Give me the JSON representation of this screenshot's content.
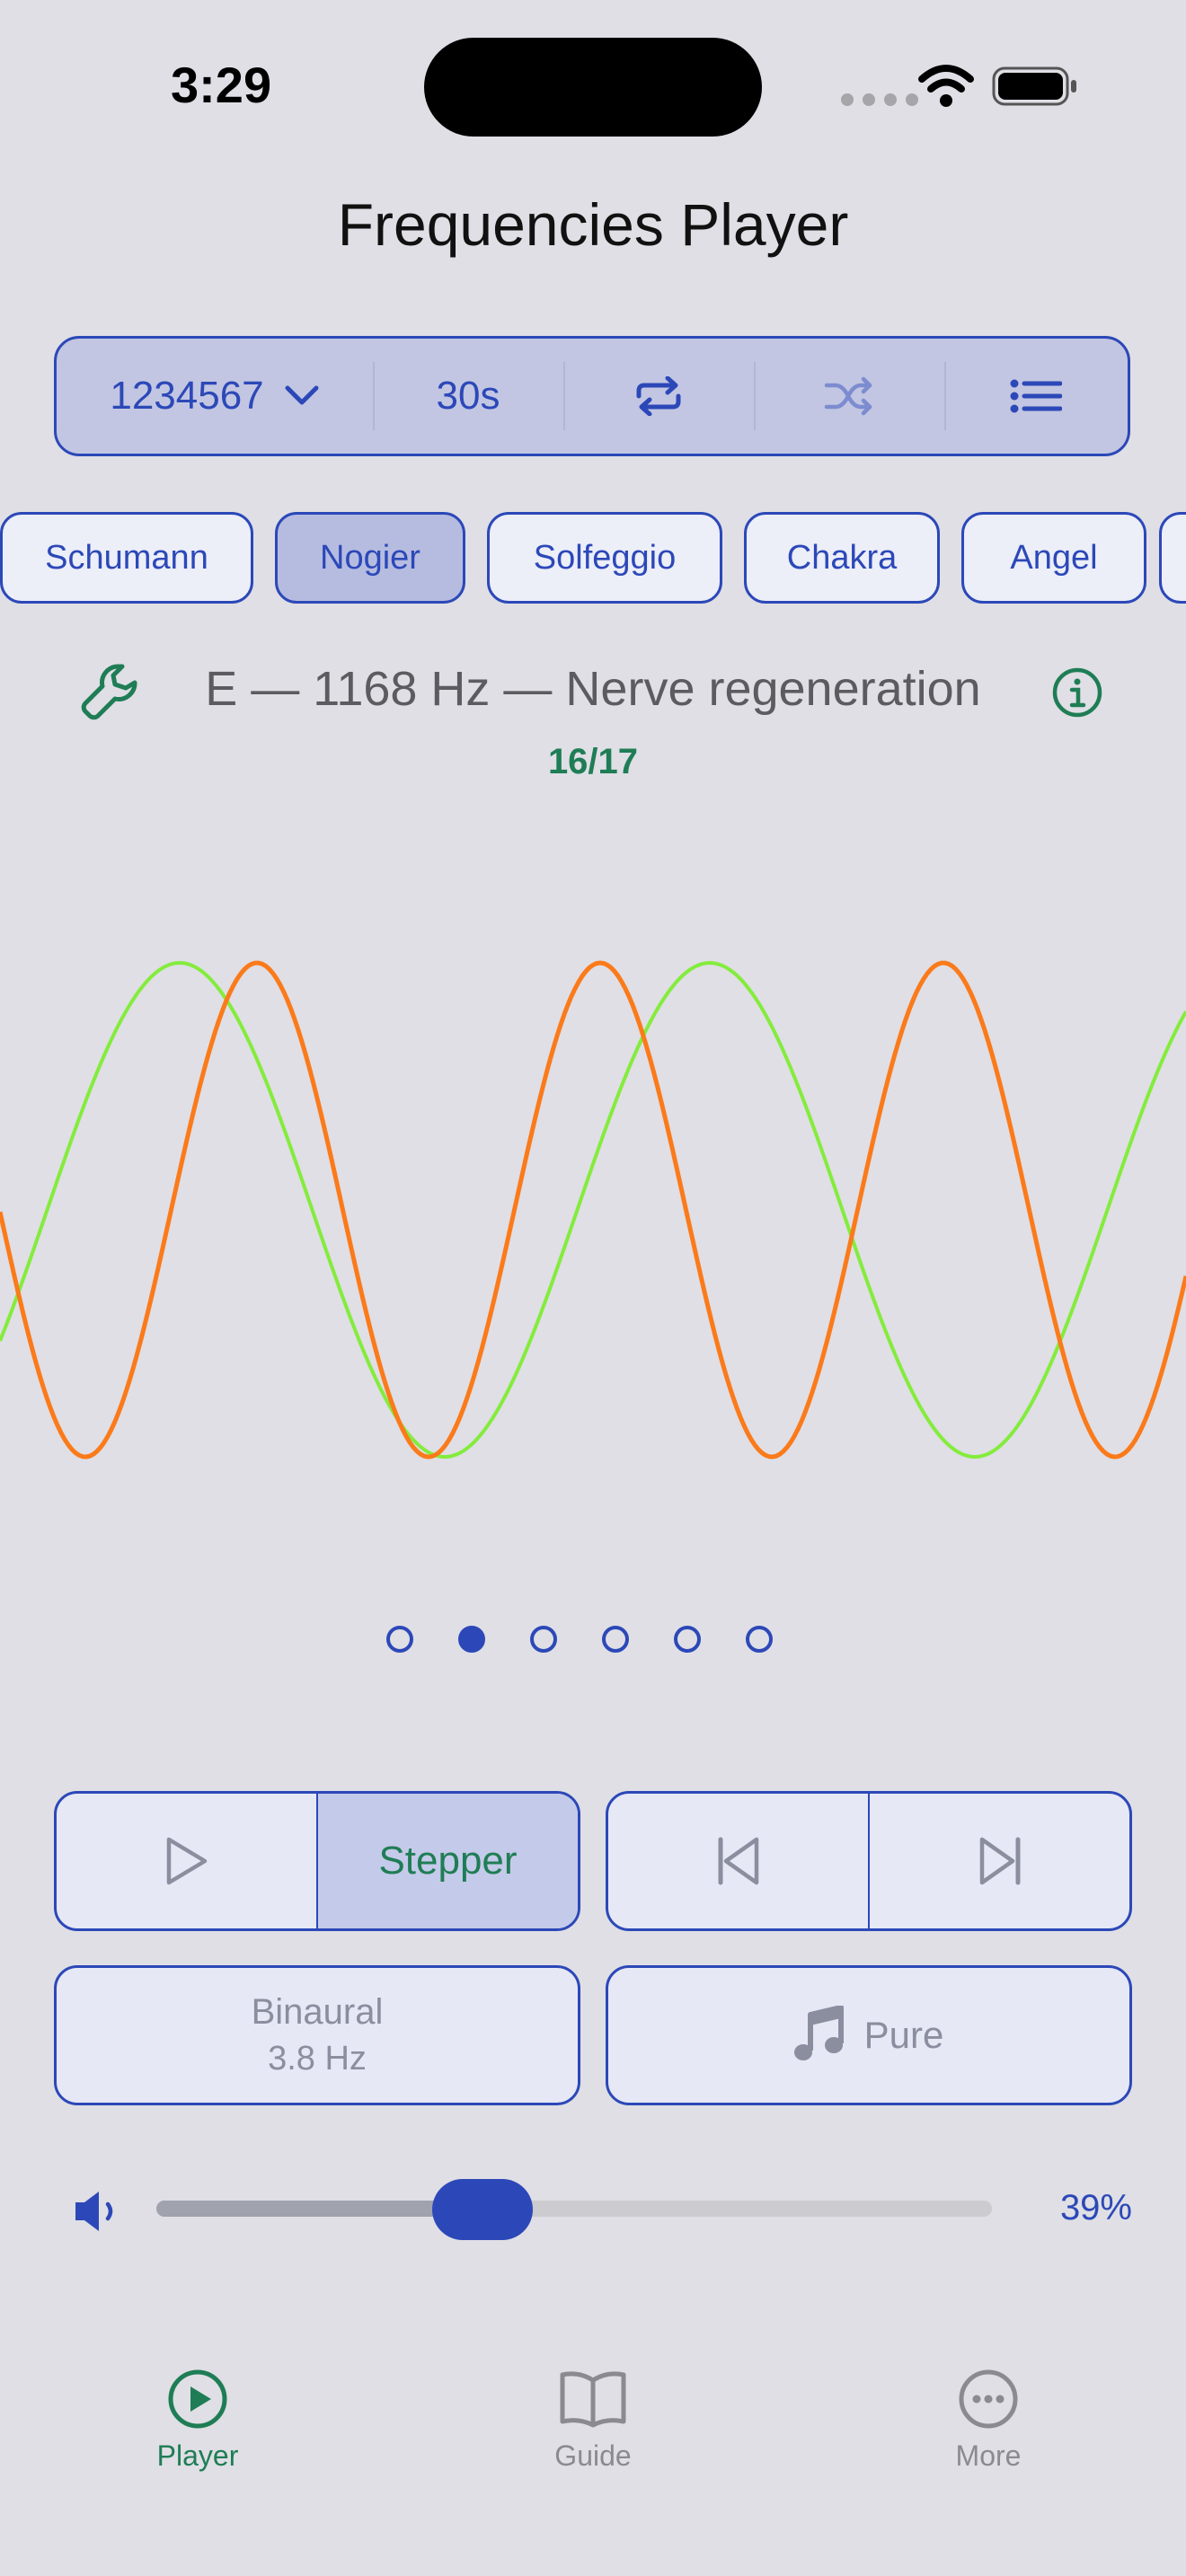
{
  "status": {
    "time": "3:29"
  },
  "app_title": "Frequencies Player",
  "controls": {
    "sequence": "1234567",
    "duration": "30s",
    "icons": [
      "chevron-down-icon",
      "repeat-icon",
      "shuffle-icon",
      "list-icon"
    ]
  },
  "categories": [
    {
      "label": "Schumann",
      "active": false
    },
    {
      "label": "Nogier",
      "active": true
    },
    {
      "label": "Solfeggio",
      "active": false
    },
    {
      "label": "Chakra",
      "active": false
    },
    {
      "label": "Angel",
      "active": false
    }
  ],
  "current": {
    "frequency_label": "E — 1168 Hz — Nerve regeneration",
    "counter": "16/17"
  },
  "waveform": {
    "colors": {
      "green": "#84ec3c",
      "orange": "#fb7a1a"
    }
  },
  "pager": {
    "count": 6,
    "active_index": 1
  },
  "playback": {
    "mode_label": "Stepper"
  },
  "sound": {
    "binaural_label": "Binaural",
    "binaural_value": "3.8 Hz",
    "tone_label": "Pure"
  },
  "volume": {
    "percent_label": "39%",
    "level": 0.39
  },
  "tabs": [
    {
      "label": "Player",
      "active": true
    },
    {
      "label": "Guide",
      "active": false
    },
    {
      "label": "More",
      "active": false
    }
  ],
  "colors": {
    "accent": "#2c48b8",
    "success": "#1f7d55",
    "background": "#dfdfe5"
  }
}
